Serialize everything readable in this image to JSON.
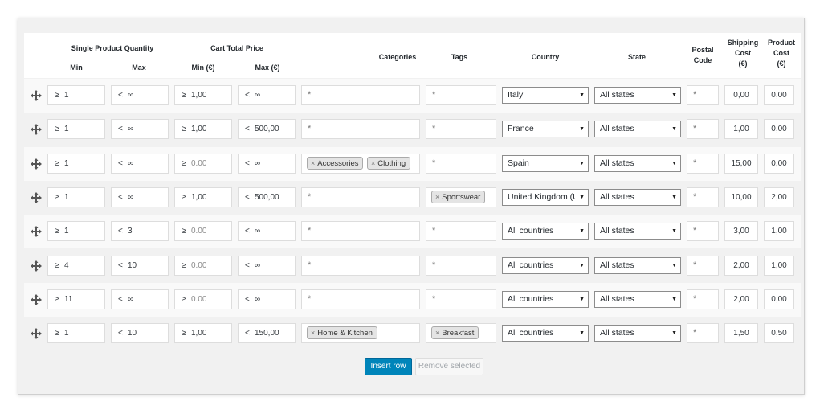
{
  "header": {
    "single_product_quantity": "Single Product Quantity",
    "cart_total_price": "Cart Total Price",
    "min": "Min",
    "max": "Max",
    "min_eur": "Min (€)",
    "max_eur": "Max (€)",
    "categories": "Categories",
    "tags": "Tags",
    "country": "Country",
    "state": "State",
    "postal_code_1": "Postal",
    "postal_code_2": "Code",
    "shipping_cost_1": "Shipping",
    "shipping_cost_2": "Cost",
    "shipping_cost_3": "(€)",
    "product_cost_1": "Product",
    "product_cost_2": "Cost",
    "product_cost_3": "(€)"
  },
  "symbols": {
    "gte": "≥",
    "lt": "<",
    "inf": "∞",
    "any": "*",
    "remove": "×",
    "arrow": "▼"
  },
  "icons": {
    "row_handle": "move-arrows-icon"
  },
  "colors": {
    "primary_button": "#0085ba",
    "panel_bg": "#f1f1f1"
  },
  "rows": [
    {
      "qty_min": "1",
      "qty_max": "∞",
      "price_min": "1,00",
      "price_min_placeholder": false,
      "price_max": "∞",
      "price_max_pfx": "<",
      "categories": [],
      "tags": [],
      "country": "Italy",
      "state": "All states",
      "postal": "*",
      "shipping": "0,00",
      "product": "0,00"
    },
    {
      "qty_min": "1",
      "qty_max": "∞",
      "price_min": "1,00",
      "price_min_placeholder": false,
      "price_max": "500,00",
      "price_max_pfx": "<",
      "categories": [],
      "tags": [],
      "country": "France",
      "state": "All states",
      "postal": "*",
      "shipping": "1,00",
      "product": "0,00"
    },
    {
      "qty_min": "1",
      "qty_max": "∞",
      "price_min": "0.00",
      "price_min_placeholder": true,
      "price_max": "∞",
      "price_max_pfx": "<",
      "categories": [
        "Accessories",
        "Clothing"
      ],
      "tags": [],
      "country": "Spain",
      "state": "All states",
      "postal": "*",
      "shipping": "15,00",
      "product": "0,00"
    },
    {
      "qty_min": "1",
      "qty_max": "∞",
      "price_min": "1,00",
      "price_min_placeholder": false,
      "price_max": "500,00",
      "price_max_pfx": "<",
      "categories": [],
      "tags": [
        "Sportswear"
      ],
      "country": "United Kingdom (UK)",
      "state": "All states",
      "postal": "*",
      "shipping": "10,00",
      "product": "2,00"
    },
    {
      "qty_min": "1",
      "qty_max": "3",
      "price_min": "0.00",
      "price_min_placeholder": true,
      "price_max": "∞",
      "price_max_pfx": "<",
      "categories": [],
      "tags": [],
      "country": "All countries",
      "state": "All states",
      "postal": "*",
      "shipping": "3,00",
      "product": "1,00"
    },
    {
      "qty_min": "4",
      "qty_max": "10",
      "price_min": "0.00",
      "price_min_placeholder": true,
      "price_max": "∞",
      "price_max_pfx": "<",
      "categories": [],
      "tags": [],
      "country": "All countries",
      "state": "All states",
      "postal": "*",
      "shipping": "2,00",
      "product": "1,00"
    },
    {
      "qty_min": "11",
      "qty_max": "∞",
      "price_min": "0.00",
      "price_min_placeholder": true,
      "price_max": "∞",
      "price_max_pfx": "<",
      "categories": [],
      "tags": [],
      "country": "All countries",
      "state": "All states",
      "postal": "*",
      "shipping": "2,00",
      "product": "0,00"
    },
    {
      "qty_min": "1",
      "qty_max": "10",
      "price_min": "1,00",
      "price_min_placeholder": false,
      "price_max": "150,00",
      "price_max_pfx": "<",
      "categories": [
        "Home & Kitchen"
      ],
      "tags": [
        "Breakfast"
      ],
      "country": "All countries",
      "state": "All states",
      "postal": "*",
      "shipping": "1,50",
      "product": "0,50"
    }
  ],
  "buttons": {
    "insert_row": "Insert row",
    "remove_selected": "Remove selected"
  }
}
